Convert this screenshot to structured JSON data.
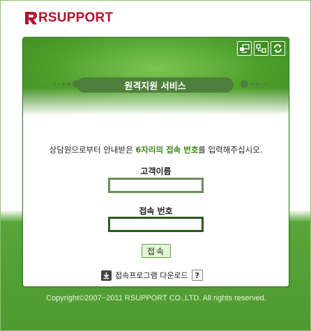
{
  "brand": {
    "name": "RSUPPORT",
    "color": "#b3132d"
  },
  "toolbar": {
    "icons": [
      "remote-screen-icon",
      "network-icon",
      "refresh-icon"
    ]
  },
  "title": "원격지원 서비스",
  "instruction": {
    "prefix": "상담원으로부터 안내받은 ",
    "highlight": "6자리의 접속 번호",
    "suffix": "를 입력해주십시오."
  },
  "form": {
    "name_label": "고객이름",
    "name_value": "",
    "code_label": "접속 번호",
    "code_value": "",
    "connect_label": "접속"
  },
  "download": {
    "label": "접속프로그램 다운로드",
    "help": "?"
  },
  "footer": "Copyright©2007~2011 RSUPPORT CO.,LTD. All rights reserved.",
  "colors": {
    "accent_green": "#3b8b1c",
    "title_bar": "#4f7f3c",
    "background_green": "#58a538"
  }
}
